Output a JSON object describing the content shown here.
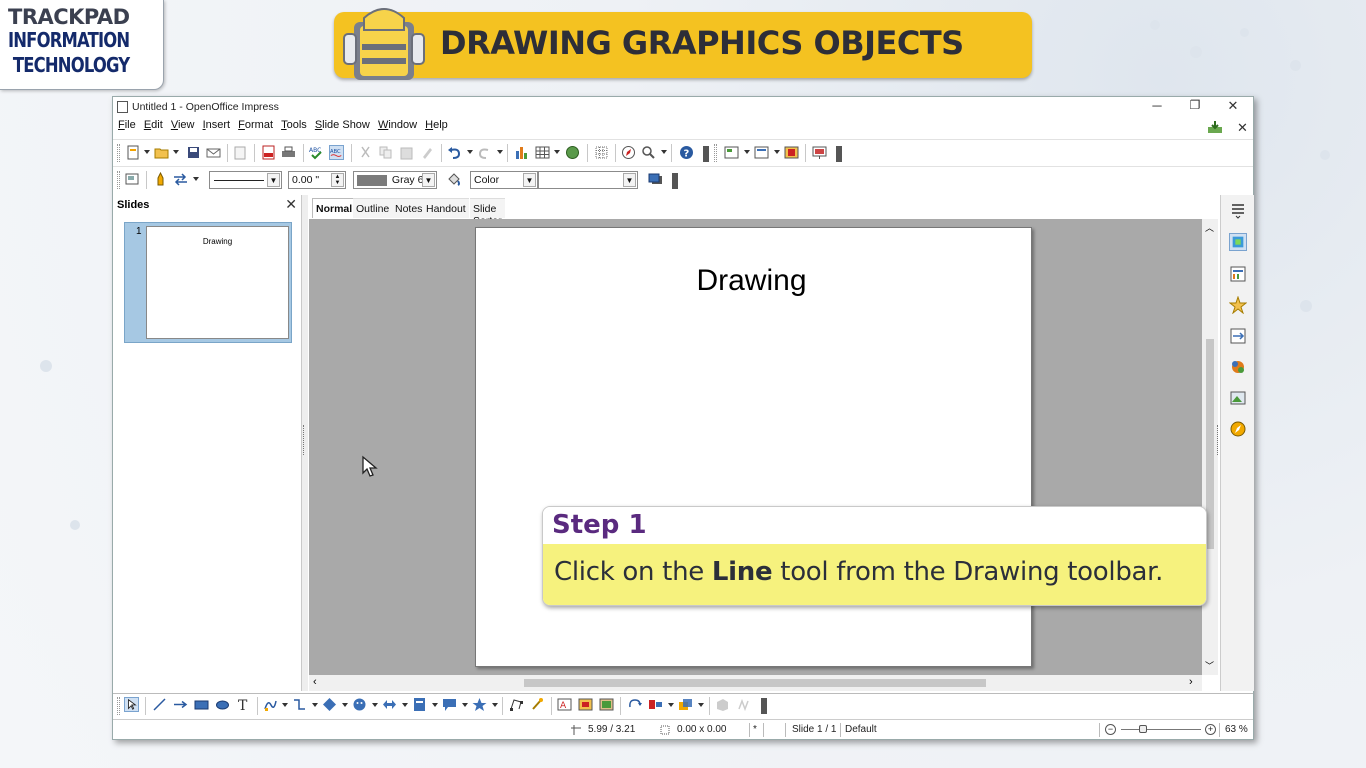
{
  "brand": {
    "line1": "TRACKPAD",
    "line2": "INFORMATION",
    "line3": "TECHNOLOGY"
  },
  "banner": {
    "title": "DRAWING GRAPHICS OBJECTS"
  },
  "window": {
    "title": "Untitled 1 - OpenOffice Impress",
    "controls": {
      "minimize": "─",
      "restore": "❐",
      "close": "✕"
    },
    "doc_close": "✕"
  },
  "menu": [
    "File",
    "Edit",
    "View",
    "Insert",
    "Format",
    "Tools",
    "Slide Show",
    "Window",
    "Help"
  ],
  "line_toolbar": {
    "line_width_value": "0.00 \"",
    "line_color": "Gray 6",
    "area_style": "Color",
    "area_fill": ""
  },
  "slides_pane": {
    "title": "Slides",
    "close": "✕",
    "slide_number": "1",
    "thumb_title": "Drawing"
  },
  "view_tabs": [
    "Normal",
    "Outline",
    "Notes",
    "Handout",
    "Slide Sorter"
  ],
  "slide": {
    "title": "Drawing"
  },
  "status_bar": {
    "position": "5.99 / 3.21",
    "size": "0.00 x 0.00",
    "modified": "*",
    "slide_info": "Slide 1 / 1",
    "layout": "Default",
    "zoom": "63 %"
  },
  "callout": {
    "step": "Step 1",
    "text_pre": "Click on the ",
    "text_bold": "Line",
    "text_post": " tool from the Drawing toolbar."
  },
  "colors": {
    "banner": "#f4c221",
    "callout_body": "#f6f27e",
    "step_text": "#5a2a7f",
    "slide_pane_selected": "#a6c8e3"
  }
}
